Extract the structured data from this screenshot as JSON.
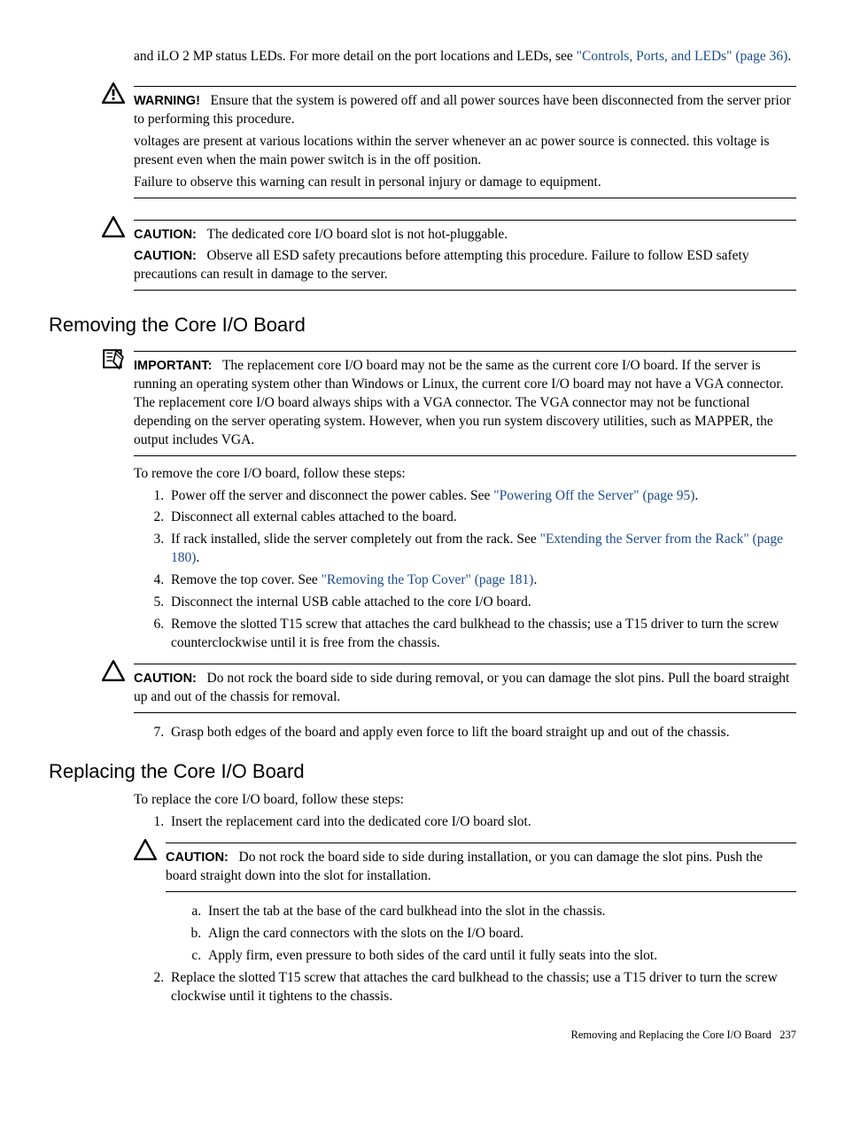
{
  "intro": {
    "text1": "and iLO 2 MP status LEDs. For more detail on the port locations and LEDs, see ",
    "link1": "\"Controls, Ports, and LEDs\" (page 36)",
    "tail1": "."
  },
  "warning": {
    "label": "WARNING!",
    "p1a": "Ensure that the system is powered off and all power sources have been disconnected from the server prior to performing this procedure.",
    "p2": "voltages are present at various locations within the server whenever an ac power source is connected. this voltage is present even when the main power switch is in the off position.",
    "p3": "Failure to observe this warning can result in personal injury or damage to equipment."
  },
  "caution1": {
    "label": "CAUTION:",
    "text": "The dedicated core I/O board slot is not hot-pluggable."
  },
  "caution2": {
    "label": "CAUTION:",
    "text": "Observe all ESD safety precautions before attempting this procedure. Failure to follow ESD safety precautions can result in damage to the server."
  },
  "section_remove": {
    "heading": "Removing the Core I/O Board",
    "important_label": "IMPORTANT:",
    "important_text": "The replacement core I/O board may not be the same as the current core I/O board. If the server is running an operating system other than Windows or Linux, the current core I/O board may not have a VGA connector. The replacement core I/O board always ships with a VGA connector. The VGA connector may not be functional depending on the server operating system. However, when you run system discovery utilities, such as MAPPER, the output includes VGA.",
    "lead": "To remove the core I/O board, follow these steps:",
    "step1_a": "Power off the server and disconnect the power cables. See ",
    "step1_link": "\"Powering Off the Server\" (page 95)",
    "step1_b": ".",
    "step2": "Disconnect all external cables attached to the board.",
    "step3_a": "If rack installed, slide the server completely out from the rack. See ",
    "step3_link": "\"Extending the Server from the Rack\" (page 180)",
    "step3_b": ".",
    "step4_a": "Remove the top cover. See ",
    "step4_link": "\"Removing the Top Cover\" (page 181)",
    "step4_b": ".",
    "step5": "Disconnect the internal USB cable attached to the core I/O board.",
    "step6": "Remove the slotted T15 screw that attaches the card bulkhead to the chassis; use a T15 driver to turn the screw counterclockwise until it is free from the chassis.",
    "caution_label": "CAUTION:",
    "caution_text": "Do not rock the board side to side during removal, or you can damage the slot pins. Pull the board straight up and out of the chassis for removal.",
    "step7": "Grasp both edges of the board and apply even force to lift the board straight up and out of the chassis."
  },
  "section_replace": {
    "heading": "Replacing the Core I/O Board",
    "lead": "To replace the core I/O board, follow these steps:",
    "step1": "Insert the replacement card into the dedicated core I/O board slot.",
    "caution_label": "CAUTION:",
    "caution_text": "Do not rock the board side to side during installation, or you can damage the slot pins. Push the board straight down into the slot for installation.",
    "sub_a": "Insert the tab at the base of the card bulkhead into the slot in the chassis.",
    "sub_b": "Align the card connectors with the slots on the I/O board.",
    "sub_c": "Apply firm, even pressure to both sides of the card until it fully seats into the slot.",
    "step2": "Replace the slotted T15 screw that attaches the card bulkhead to the chassis; use a T15 driver to turn the screw clockwise until it tightens to the chassis."
  },
  "footer": {
    "text": "Removing and Replacing the Core I/O Board",
    "page": "237"
  }
}
